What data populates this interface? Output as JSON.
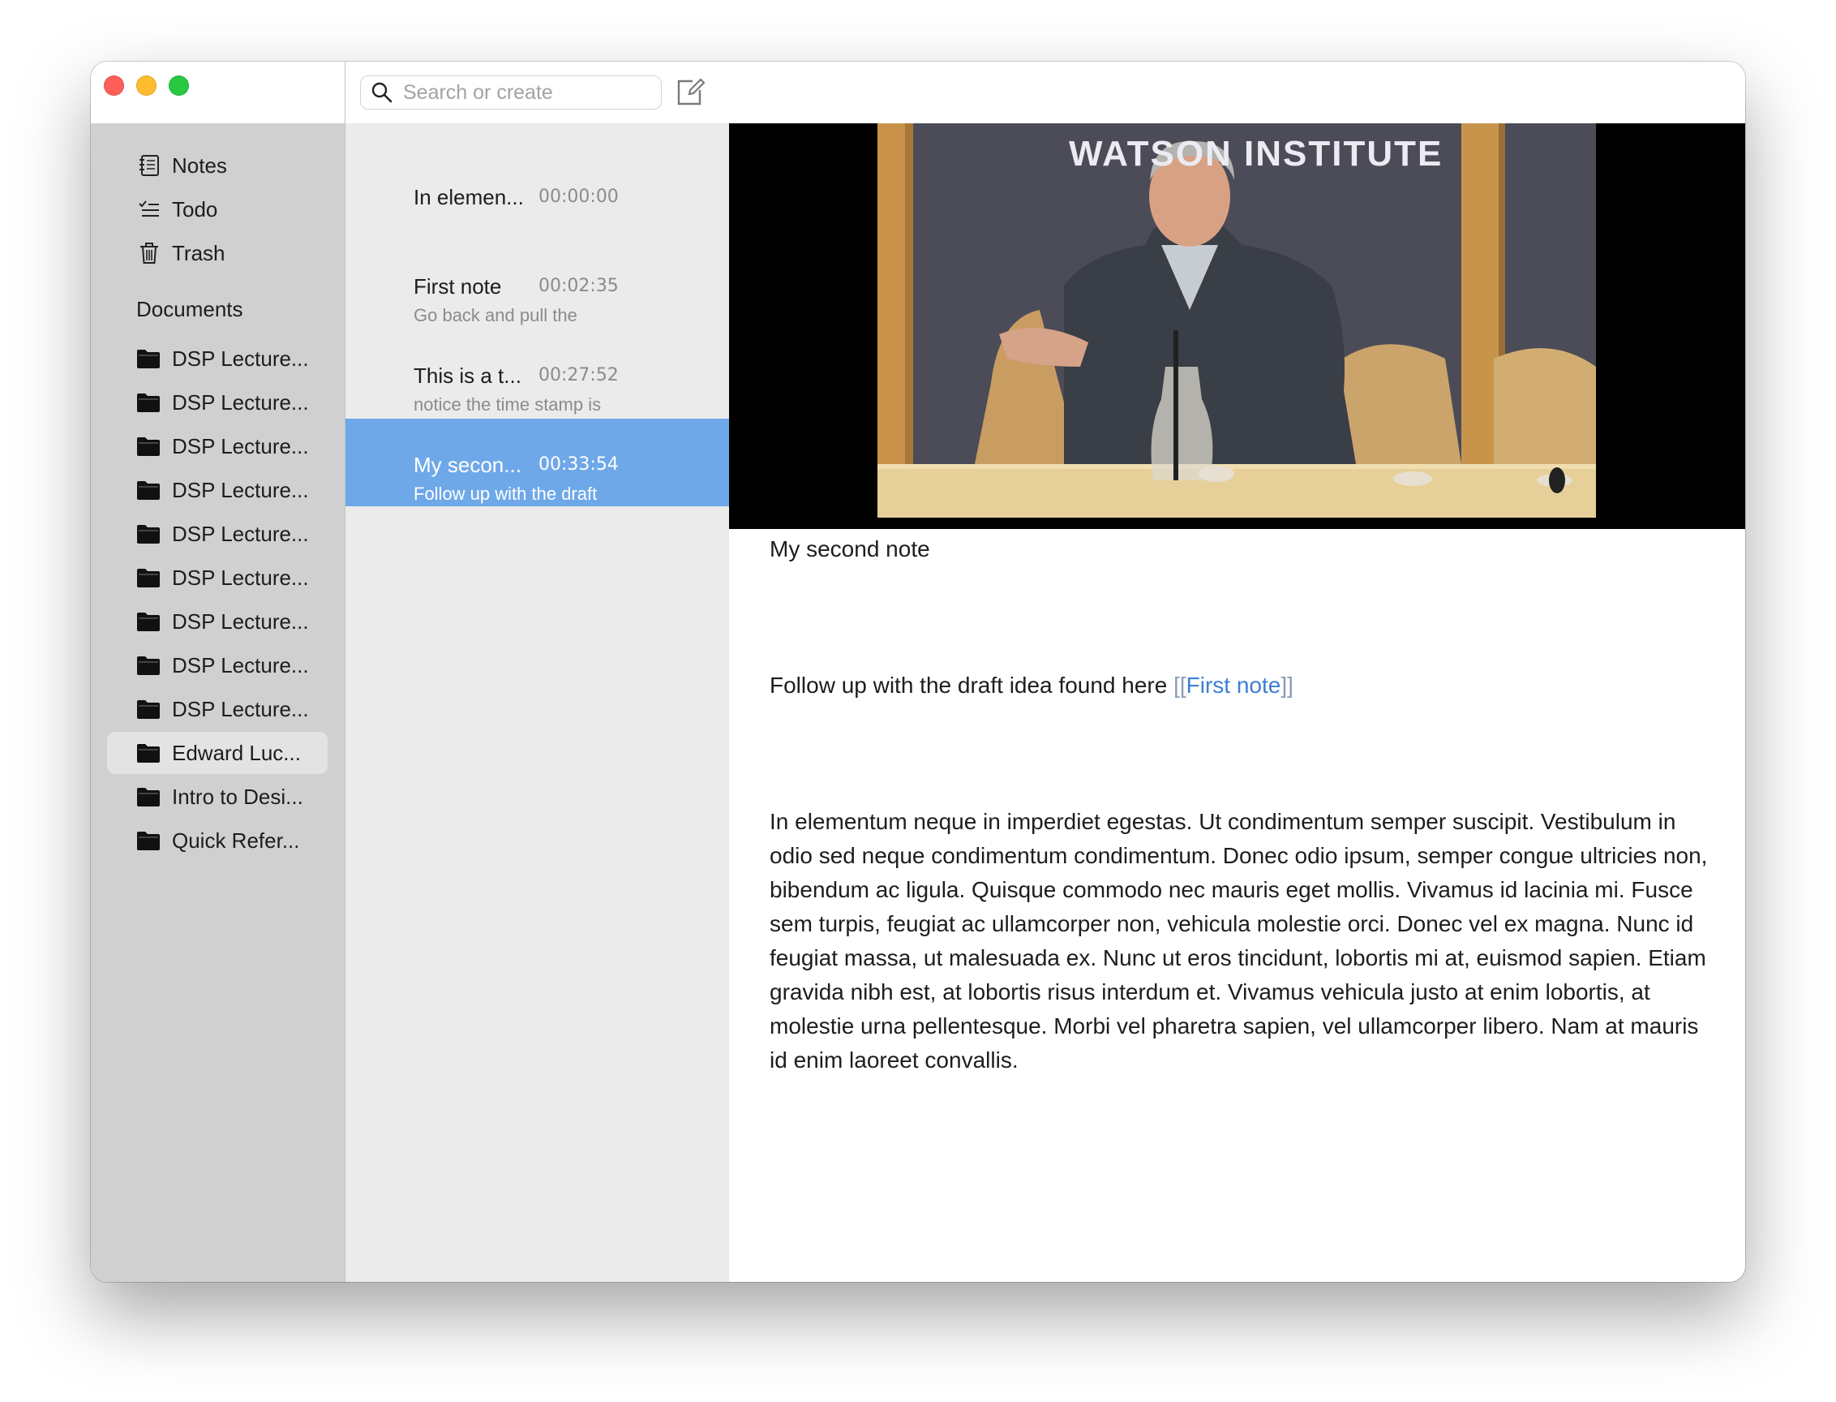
{
  "sidebar": {
    "nav": [
      {
        "label": "Notes",
        "icon": "notebook-icon"
      },
      {
        "label": "Todo",
        "icon": "checklist-icon"
      },
      {
        "label": "Trash",
        "icon": "trash-icon"
      }
    ],
    "section_label": "Documents",
    "documents": [
      {
        "label": "DSP Lecture..."
      },
      {
        "label": "DSP Lecture..."
      },
      {
        "label": "DSP Lecture..."
      },
      {
        "label": "DSP Lecture..."
      },
      {
        "label": "DSP Lecture..."
      },
      {
        "label": "DSP Lecture..."
      },
      {
        "label": "DSP Lecture..."
      },
      {
        "label": "DSP Lecture..."
      },
      {
        "label": "DSP Lecture..."
      },
      {
        "label": "Edward Luc..."
      },
      {
        "label": "Intro to Desi..."
      },
      {
        "label": "Quick Refer..."
      }
    ],
    "active_document": 9
  },
  "search": {
    "placeholder": "Search or create",
    "value": ""
  },
  "notes": [
    {
      "title": "In elemen...",
      "time": "00:00:00",
      "preview": ""
    },
    {
      "title": "First note",
      "time": "00:02:35",
      "preview": "Go back and pull the"
    },
    {
      "title": "This is a t...",
      "time": "00:27:52",
      "preview": "notice the time stamp is"
    },
    {
      "title": "My secon...",
      "time": "00:33:54",
      "preview": "Follow up with the draft"
    }
  ],
  "selected_note": 3,
  "video": {
    "banner": "WATSON INSTITUTE"
  },
  "editor": {
    "title": "My second note",
    "link_line_prefix": "Follow up with the draft idea found here ",
    "link_open": "[[",
    "link_text": "First note",
    "link_close": "]]",
    "body": "In elementum neque in imperdiet egestas. Ut condimentum semper suscipit. Vestibulum in odio sed neque condimentum condimentum. Donec odio ipsum, semper congue ultricies non, bibendum ac ligula. Quisque commodo nec mauris eget mollis. Vivamus id lacinia mi. Fusce sem turpis, feugiat ac ullamcorper non, vehicula molestie orci. Donec vel ex magna. Nunc id feugiat massa, ut malesuada ex. Nunc ut eros tincidunt, lobortis mi at, euismod sapien. Etiam gravida nibh est, at lobortis risus interdum et. Vivamus vehicula justo at enim lobortis, at molestie urna pellentesque. Morbi vel pharetra sapien, vel ullamcorper libero. Nam at mauris id enim laoreet convallis."
  },
  "colors": {
    "selection": "#6ea8e8",
    "link": "#3b7fd6",
    "sidebar": "#d0d0d0",
    "list": "#ebebeb"
  }
}
